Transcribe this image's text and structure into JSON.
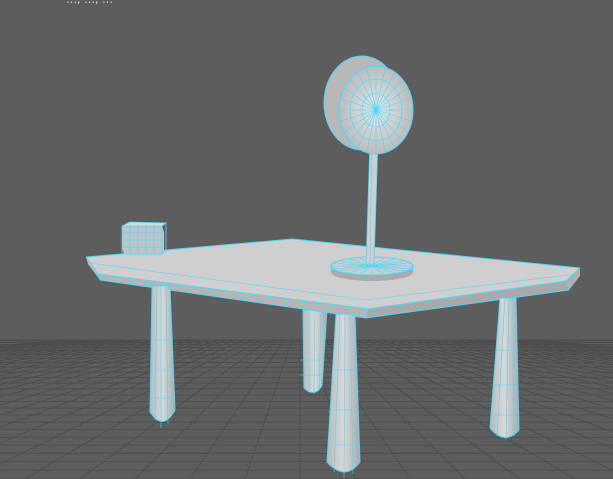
{
  "viewport": {
    "label": "…, …, …"
  },
  "scene": {
    "objects": [
      "grid",
      "table",
      "cube",
      "round-mirror"
    ],
    "colors": {
      "background": "#5d5d5d",
      "grid_line": "#4a4a4a",
      "selection_wire": "#48d8ff",
      "surface": "#c9c9c9",
      "surface_dark": "#a8a8a8"
    },
    "icons": {
      "perspective": "perspective-viewport-icon"
    }
  }
}
